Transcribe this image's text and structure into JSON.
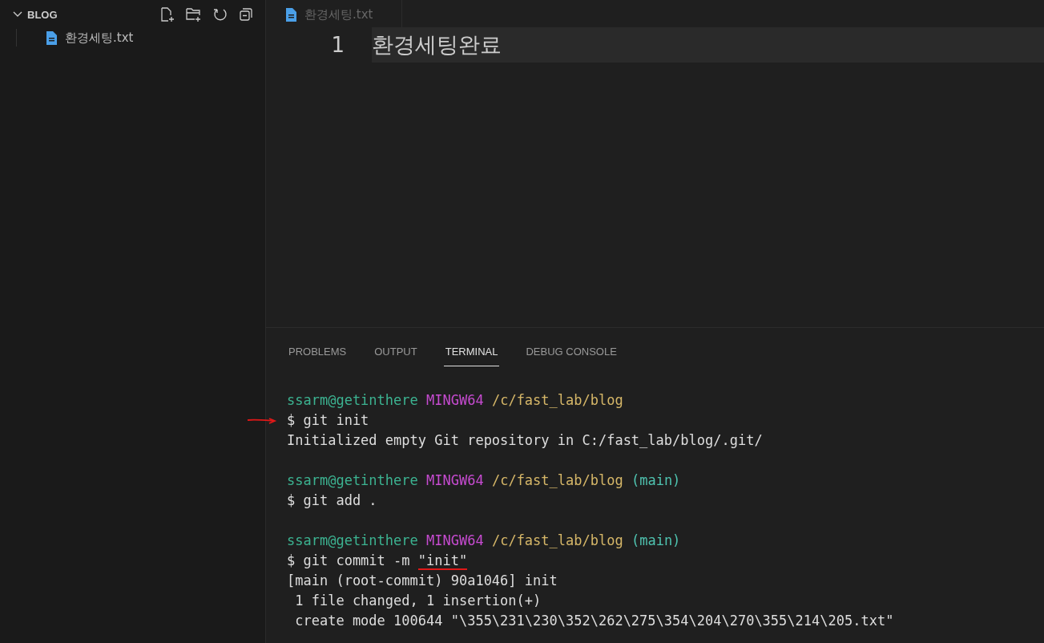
{
  "explorer": {
    "title": "BLOG",
    "expanded": true,
    "files": [
      {
        "name": "환경세팅.txt",
        "selected": false
      }
    ]
  },
  "editor": {
    "tab": {
      "label": "환경세팅.txt",
      "selected": false
    },
    "lines": [
      {
        "number": "1",
        "text": "환경세팅완료"
      }
    ]
  },
  "panel": {
    "tabs": [
      {
        "label": "PROBLEMS",
        "selected": false
      },
      {
        "label": "OUTPUT",
        "selected": false
      },
      {
        "label": "TERMINAL",
        "selected": true
      },
      {
        "label": "DEBUG CONSOLE",
        "selected": false
      }
    ],
    "terminal": [
      {
        "kind": "prompt",
        "user": "ssarm@getinthere",
        "system": "MINGW64",
        "path": "/c/fast_lab/blog"
      },
      {
        "kind": "command",
        "text": "$ git init",
        "arrow": true
      },
      {
        "kind": "output",
        "text": "Initialized empty Git repository in C:/fast_lab/blog/.git/"
      },
      {
        "kind": "blank"
      },
      {
        "kind": "prompt",
        "user": "ssarm@getinthere",
        "system": "MINGW64",
        "path": "/c/fast_lab/blog",
        "branch": "(main)"
      },
      {
        "kind": "command",
        "text": "$ git add ."
      },
      {
        "kind": "blank"
      },
      {
        "kind": "prompt",
        "user": "ssarm@getinthere",
        "system": "MINGW64",
        "path": "/c/fast_lab/blog",
        "branch": "(main)"
      },
      {
        "kind": "command",
        "text": "$ git commit -m ",
        "underlined": "\"init\""
      },
      {
        "kind": "output",
        "text": "[main (root-commit) 90a1046] init"
      },
      {
        "kind": "output",
        "text": " 1 file changed, 1 insertion(+)"
      },
      {
        "kind": "output",
        "text": " create mode 100644 \"\\355\\231\\230\\352\\262\\275\\354\\204\\270\\355\\214\\205.txt\""
      }
    ]
  }
}
